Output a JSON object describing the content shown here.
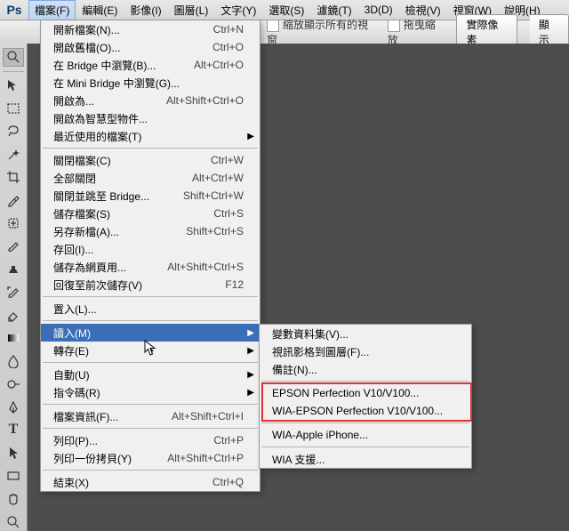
{
  "menubar": {
    "items": [
      "檔案(F)",
      "編輯(E)",
      "影像(I)",
      "圖層(L)",
      "文字(Y)",
      "選取(S)",
      "濾鏡(T)",
      "3D(D)",
      "檢視(V)",
      "視窗(W)",
      "說明(H)"
    ]
  },
  "optbar": {
    "fit_windows": "縮放顯示所有的視窗",
    "scrubby": "拖曳縮放",
    "actual_pixels": "實際像素",
    "fit_screen": "顯示"
  },
  "file_menu": {
    "sections": [
      [
        {
          "label": "開新檔案(N)...",
          "shortcut": "Ctrl+N"
        },
        {
          "label": "開啟舊檔(O)...",
          "shortcut": "Ctrl+O"
        },
        {
          "label": "在 Bridge 中瀏覽(B)...",
          "shortcut": "Alt+Ctrl+O"
        },
        {
          "label": "在 Mini Bridge 中瀏覽(G)..."
        },
        {
          "label": "開啟為...",
          "shortcut": "Alt+Shift+Ctrl+O"
        },
        {
          "label": "開啟為智慧型物件..."
        },
        {
          "label": "最近使用的檔案(T)",
          "submenu": true
        }
      ],
      [
        {
          "label": "關閉檔案(C)",
          "shortcut": "Ctrl+W"
        },
        {
          "label": "全部關閉",
          "shortcut": "Alt+Ctrl+W"
        },
        {
          "label": "關閉並跳至 Bridge...",
          "shortcut": "Shift+Ctrl+W"
        },
        {
          "label": "儲存檔案(S)",
          "shortcut": "Ctrl+S"
        },
        {
          "label": "另存新檔(A)...",
          "shortcut": "Shift+Ctrl+S"
        },
        {
          "label": "存回(I)..."
        },
        {
          "label": "儲存為網頁用...",
          "shortcut": "Alt+Shift+Ctrl+S"
        },
        {
          "label": "回復至前次儲存(V)",
          "shortcut": "F12"
        }
      ],
      [
        {
          "label": "置入(L)..."
        }
      ],
      [
        {
          "label": "讀入(M)",
          "submenu": true,
          "highlight": true
        },
        {
          "label": "轉存(E)",
          "submenu": true
        }
      ],
      [
        {
          "label": "自動(U)",
          "submenu": true
        },
        {
          "label": "指令碼(R)",
          "submenu": true
        }
      ],
      [
        {
          "label": "檔案資訊(F)...",
          "shortcut": "Alt+Shift+Ctrl+I"
        }
      ],
      [
        {
          "label": "列印(P)...",
          "shortcut": "Ctrl+P"
        },
        {
          "label": "列印一份拷貝(Y)",
          "shortcut": "Alt+Shift+Ctrl+P"
        }
      ],
      [
        {
          "label": "結束(X)",
          "shortcut": "Ctrl+Q"
        }
      ]
    ]
  },
  "import_submenu": {
    "sections": [
      [
        {
          "label": "變數資料集(V)..."
        },
        {
          "label": "視訊影格到圖層(F)..."
        },
        {
          "label": "備註(N)..."
        }
      ],
      [
        {
          "label": "EPSON Perfection V10/V100..."
        },
        {
          "label": "WIA-EPSON Perfection V10/V100..."
        }
      ],
      [
        {
          "label": "WIA-Apple iPhone..."
        }
      ],
      [
        {
          "label": "WIA 支援..."
        }
      ]
    ]
  },
  "tools": [
    {
      "name": "zoom-tool"
    },
    {
      "name": "divider"
    },
    {
      "name": "move-tool"
    },
    {
      "name": "rect-marquee-tool"
    },
    {
      "name": "lasso-tool"
    },
    {
      "name": "magic-wand-tool"
    },
    {
      "name": "crop-tool"
    },
    {
      "name": "eyedropper-tool"
    },
    {
      "name": "healing-brush-tool"
    },
    {
      "name": "brush-tool"
    },
    {
      "name": "clone-stamp-tool"
    },
    {
      "name": "history-brush-tool"
    },
    {
      "name": "eraser-tool"
    },
    {
      "name": "gradient-tool"
    },
    {
      "name": "blur-tool"
    },
    {
      "name": "dodge-tool"
    },
    {
      "name": "pen-tool"
    },
    {
      "name": "type-tool"
    },
    {
      "name": "path-selection-tool"
    },
    {
      "name": "rectangle-tool"
    },
    {
      "name": "hand-tool"
    },
    {
      "name": "magnify-tool"
    }
  ]
}
